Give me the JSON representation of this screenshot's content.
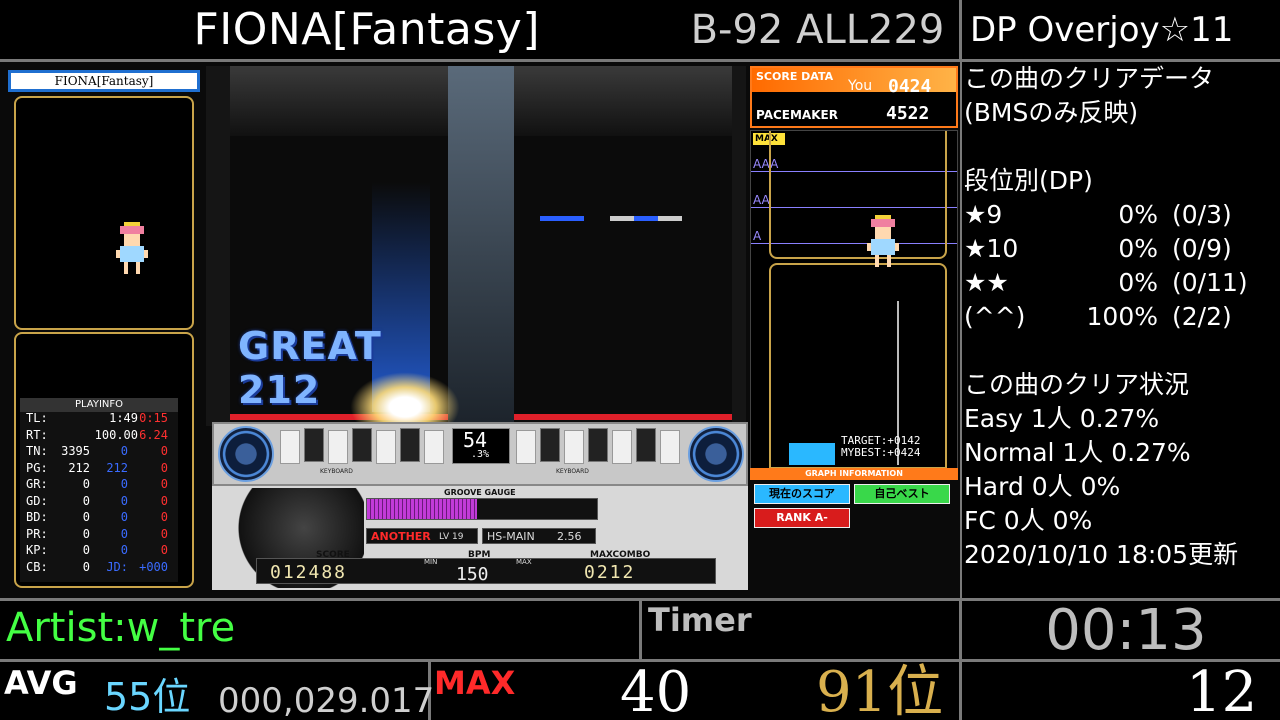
{
  "header": {
    "title": "FIONA[Fantasy]",
    "chart_info": "B-92 ALL229",
    "difficulty": "DP Overjoy☆11"
  },
  "clear_data": {
    "heading1": "この曲のクリアデータ",
    "heading2": "(BMSのみ反映)",
    "dan_heading": "段位別(DP)",
    "dan_rows": [
      {
        "label": "★9",
        "pct": "0%",
        "count": "(0/3)"
      },
      {
        "label": "★10",
        "pct": "0%",
        "count": "(0/9)"
      },
      {
        "label": "★★",
        "pct": "0%",
        "count": "(0/11)"
      },
      {
        "label": "(^^)",
        "pct": "100%",
        "count": "(2/2)"
      }
    ],
    "status_heading": "この曲のクリア状況",
    "status_rows": [
      "Easy 1人 0.27%",
      "Normal  1人 0.27%",
      "Hard 0人 0%",
      "FC 0人 0%"
    ],
    "updated": "2020/10/10  18:05更新"
  },
  "game": {
    "song_label": "FIONA[Fantasy]",
    "judge_text": "GREAT 212",
    "combo_pct": "54",
    "combo_pct_small": ".3%",
    "groove_gauge_label": "GROOVE GAUGE",
    "another_label": "ANOTHER",
    "level_label": "LV 19",
    "hs_label": "HS-MAIN",
    "hs_value": "2.56",
    "score_label": "SCORE",
    "score_value": "012488",
    "bpm_label": "BPM",
    "bpm_min_label": "MIN",
    "bpm_max_label": "MAX",
    "bpm_value": "150",
    "maxcombo_label": "MAXCOMBO",
    "maxcombo_value": "0212",
    "keyboard_label": "KEYBOARD",
    "score_data": {
      "title": "SCORE DATA",
      "you_label": "You",
      "you_value": "0424",
      "pacemaker_label": "PACEMAKER",
      "pacemaker_value": "4522",
      "grade_max": "MAX",
      "grade_aaa": "AAA",
      "grade_aa": "AA",
      "grade_a": "A",
      "target_label": "TARGET:",
      "target_value": "+0142",
      "mybest_label": "MYBEST:",
      "mybest_value": "+0424",
      "graph_info": "GRAPH INFORMATION",
      "btn_current": "現在のスコア",
      "btn_best": "自己ベスト",
      "btn_rank": "RANK A-"
    },
    "playinfo": {
      "title": "PLAYINFO",
      "rows": [
        {
          "k": "TL:",
          "v": "1:49",
          "r": "0:15"
        },
        {
          "k": "RT:",
          "v": "100.00",
          "r": "6.24"
        },
        {
          "k": "TN:",
          "v": "3395",
          "b": "0",
          "r": "0"
        },
        {
          "k": "PG:",
          "v": "212",
          "b": "212",
          "r": "0"
        },
        {
          "k": "GR:",
          "v": "0",
          "b": "0",
          "r": "0"
        },
        {
          "k": "GD:",
          "v": "0",
          "b": "0",
          "r": "0"
        },
        {
          "k": "BD:",
          "v": "0",
          "b": "0",
          "r": "0"
        },
        {
          "k": "PR:",
          "v": "0",
          "b": "0",
          "r": "0"
        },
        {
          "k": "KP:",
          "v": "0",
          "b": "0",
          "r": "0"
        },
        {
          "k": "CB:",
          "v": "0",
          "b": "JD:",
          "r": "+000"
        }
      ]
    }
  },
  "footer": {
    "artist": "Artist:w_tre",
    "timer_label": "Timer",
    "timer_value": "00:13",
    "avg_label": "AVG",
    "avg_rank": "55位",
    "avg_value": "000,029.017",
    "max_label": "MAX",
    "max_value": "40",
    "max_rank": "91位",
    "last_value": "12"
  },
  "colors": {
    "accent_green": "#44ff44",
    "rank_blue": "#6ad6ff",
    "max_red": "#ff2a2a",
    "gold": "#d9b04e"
  }
}
